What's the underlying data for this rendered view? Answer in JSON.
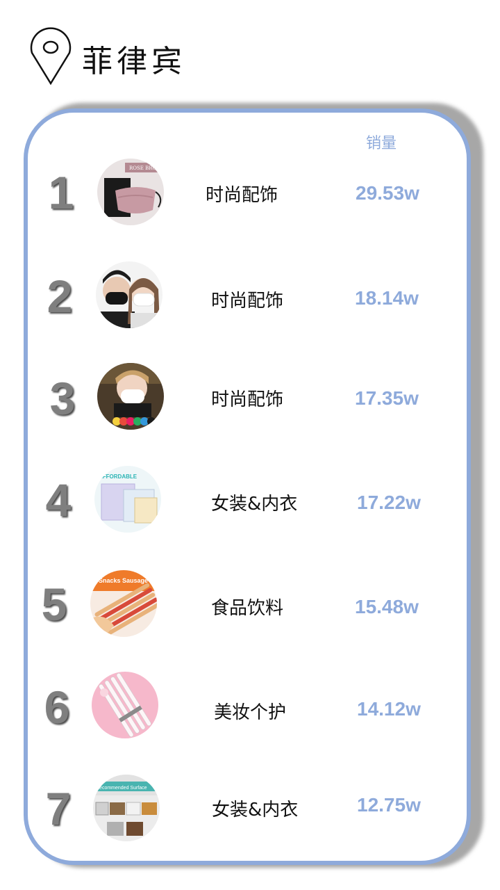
{
  "header": {
    "title": "菲律宾",
    "icon": "location-pin-icon"
  },
  "table": {
    "sales_column_label": "销量",
    "accent_color": "#8eaadb",
    "rows": [
      {
        "rank": "1",
        "category": "时尚配饰",
        "sales": "29.53w",
        "thumb": "pink-face-mask-product"
      },
      {
        "rank": "2",
        "category": "时尚配饰",
        "sales": "18.14w",
        "thumb": "couple-wearing-masks"
      },
      {
        "rank": "3",
        "category": "时尚配饰",
        "sales": "17.35w",
        "thumb": "woman-wearing-white-mask"
      },
      {
        "rank": "4",
        "category": "女装&内衣",
        "sales": "17.22w",
        "thumb": "wall-panels-product"
      },
      {
        "rank": "5",
        "category": "食品饮料",
        "sales": "15.48w",
        "thumb": "snack-sausages-product"
      },
      {
        "rank": "6",
        "category": "美妆个护",
        "sales": "14.12w",
        "thumb": "pink-pens-product"
      },
      {
        "rank": "7",
        "category": "女装&内衣",
        "sales": "12.75w",
        "thumb": "wall-stickers-product"
      }
    ],
    "thumb_texts": {
      "row1": "ROSE BROWN",
      "row4": "AFFORDABLE",
      "row5": "Snacks Sausage",
      "row7": "Recommended Surface"
    }
  }
}
